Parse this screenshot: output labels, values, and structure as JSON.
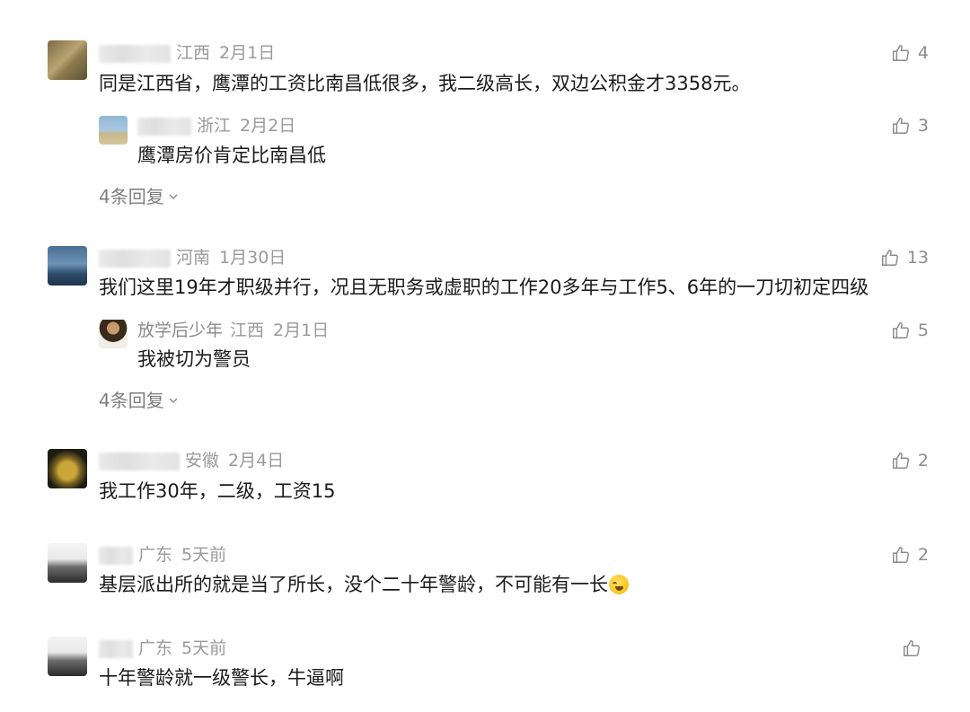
{
  "comments": [
    {
      "region": "江西",
      "date": "2月1日",
      "likes": "4",
      "text": "同是江西省，鹰潭的工资比南昌低很多，我二级高长，双边公积金才3358元。",
      "reply": {
        "region": "浙江",
        "date": "2月2日",
        "likes": "3",
        "text": "鹰潭房价肯定比南昌低"
      },
      "more": "4条回复"
    },
    {
      "region": "河南",
      "date": "1月30日",
      "likes": "13",
      "text": "我们这里19年才职级并行，况且无职务或虚职的工作20多年与工作5、6年的一刀切初定四级",
      "reply": {
        "name": "放学后少年",
        "region": "江西",
        "date": "2月1日",
        "likes": "5",
        "text": "我被切为警员"
      },
      "more": "4条回复"
    },
    {
      "region": "安徽",
      "date": "2月4日",
      "likes": "2",
      "text": "我工作30年，二级，工资15"
    },
    {
      "region": "广东",
      "date": "5天前",
      "likes": "2",
      "text": "基层派出所的就是当了所长，没个二十年警龄，不可能有一长"
    },
    {
      "region": "广东",
      "date": "5天前",
      "likes": "",
      "text": "十年警龄就一级警长，牛逼啊"
    }
  ],
  "icons": {
    "like": "thumbs-up-icon",
    "expand": "chevron-down-icon",
    "emoji": "laughing-tears-emoji"
  },
  "colors": {
    "meta": "#9a9a9a",
    "text": "#1a1a1a",
    "accent": "#8c8c8c"
  }
}
